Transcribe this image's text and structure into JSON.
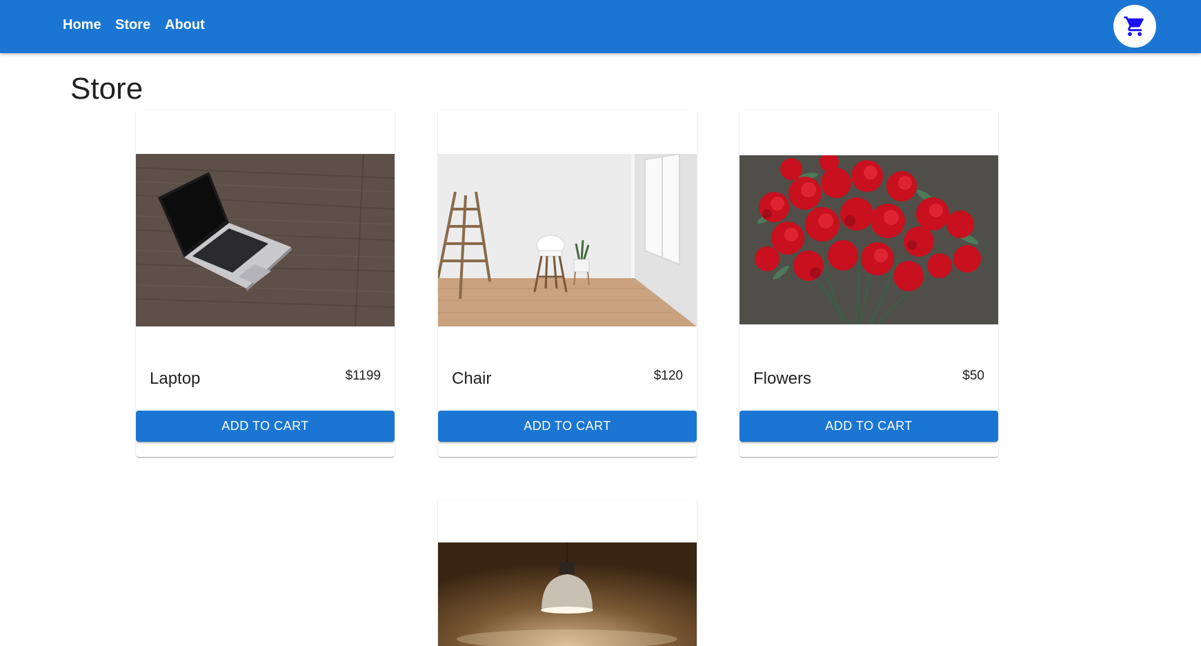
{
  "nav": {
    "links": [
      "Home",
      "Store",
      "About"
    ],
    "cart_icon": "shopping-cart-icon"
  },
  "page": {
    "title": "Store"
  },
  "products": [
    {
      "name": "Laptop",
      "price": "$1199",
      "button": "ADD TO CART",
      "image": "laptop-photo"
    },
    {
      "name": "Chair",
      "price": "$120",
      "button": "ADD TO CART",
      "image": "chair-photo"
    },
    {
      "name": "Flowers",
      "price": "$50",
      "button": "ADD TO CART",
      "image": "flowers-photo"
    },
    {
      "name": "",
      "price": "",
      "button": "",
      "image": "lamp-photo"
    }
  ],
  "colors": {
    "primary": "#1a76d2",
    "cart_icon": "#1c12f2",
    "text": "#212121"
  }
}
